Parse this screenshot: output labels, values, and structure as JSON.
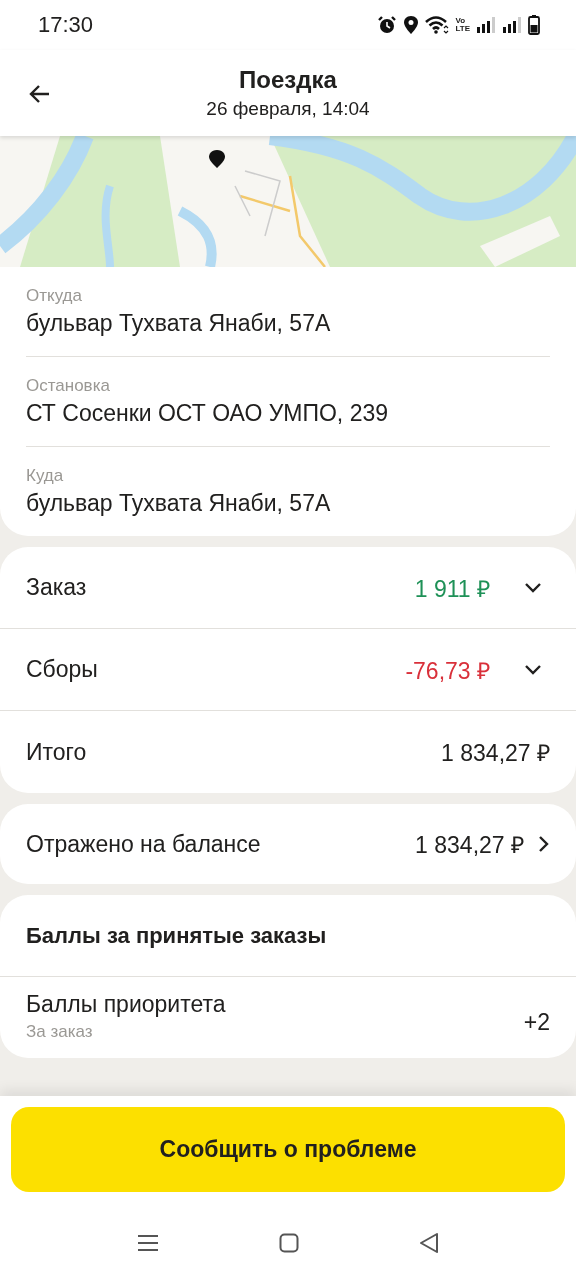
{
  "status_bar": {
    "time": "17:30",
    "volte": [
      "Vo",
      "LTE"
    ]
  },
  "header": {
    "title": "Поездка",
    "subtitle": "26 февраля, 14:04"
  },
  "route": [
    {
      "label": "Откуда",
      "value": "бульвар Тухвата Янаби, 57А"
    },
    {
      "label": "Остановка",
      "value": "СТ Сосенки ОСТ ОАО УМПО, 239"
    },
    {
      "label": "Куда",
      "value": "бульвар Тухвата Янаби, 57А"
    }
  ],
  "charges": [
    {
      "kind": "expandable",
      "label": "Заказ",
      "amount": "1 911 ₽",
      "color": "#1e9157",
      "expanded": false
    },
    {
      "kind": "expandable",
      "label": "Сборы",
      "amount": "-76,73 ₽",
      "color": "#d9303a",
      "expanded": false
    },
    {
      "kind": "plain",
      "label": "Итого",
      "amount": "1 834,27 ₽",
      "color": "#21201f"
    }
  ],
  "balance": {
    "label": "Отражено на балансе",
    "amount": "1 834,27 ₽"
  },
  "points": {
    "title": "Баллы за принятые заказы",
    "items": [
      {
        "label": "Баллы приоритета",
        "sublabel": "За заказ",
        "value": "+2"
      }
    ]
  },
  "report_button": "Сообщить о проблеме"
}
